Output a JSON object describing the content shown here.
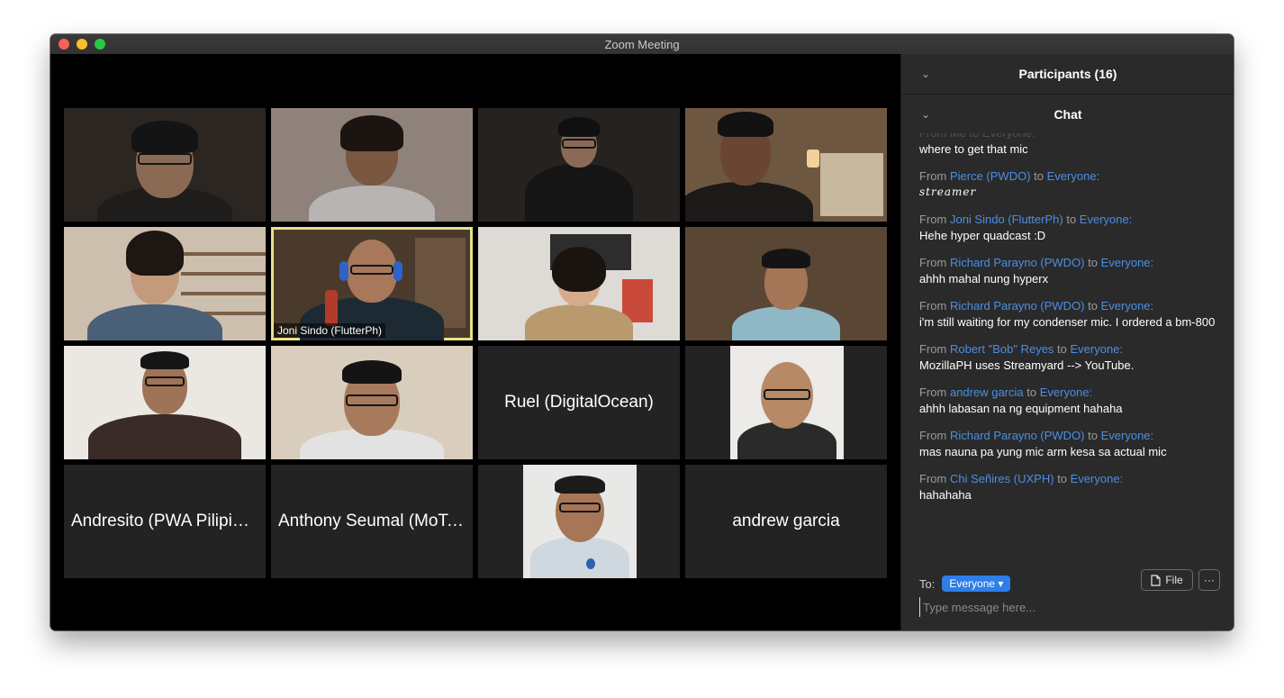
{
  "window": {
    "title": "Zoom Meeting"
  },
  "participants_panel": {
    "title": "Participants (16)"
  },
  "chat_panel": {
    "title": "Chat",
    "partial_top": {
      "prefix": "From Me to Everyone:",
      "text": "where to get that mic"
    },
    "messages": [
      {
        "from": "Pierce (PWDO)",
        "to": "Everyone:",
        "text": "streamer"
      },
      {
        "from": "Joni Sindo (FlutterPh)",
        "to": "Everyone:",
        "text": "Hehe hyper quadcast :D"
      },
      {
        "from": "Richard Parayno (PWDO)",
        "to": "Everyone:",
        "text": "ahhh mahal nung hyperx"
      },
      {
        "from": "Richard Parayno (PWDO)",
        "to": "Everyone:",
        "text": "i'm still waiting for my condenser mic. I ordered a bm-800"
      },
      {
        "from": "Robert \"Bob\" Reyes",
        "to": "Everyone:",
        "text": "MozillaPH uses Streamyard --> YouTube."
      },
      {
        "from": "andrew garcia",
        "to": "Everyone:",
        "text": "ahhh labasan na ng equipment hahaha"
      },
      {
        "from": "Richard Parayno (PWDO)",
        "to": "Everyone:",
        "text": "mas nauna pa yung mic arm kesa sa actual mic"
      },
      {
        "from": "Chi Señires (UXPH)",
        "to": "Everyone:",
        "text": "hahahaha"
      }
    ],
    "words": {
      "from": "From",
      "to": "to"
    },
    "to_label": "To:",
    "recipient": "Everyone ▾",
    "file_label": "File",
    "more_label": "···",
    "input_placeholder": "Type message here..."
  },
  "gallery": {
    "active_name_tag": "Joni Sindo (FlutterPh)",
    "name_tiles": {
      "ruel": "Ruel (DigitalOcean)",
      "andresito": "Andresito (PWA Pilipinas)",
      "anthony": "Anthony Seumal (MoTeam)",
      "andrew": "andrew garcia"
    }
  }
}
